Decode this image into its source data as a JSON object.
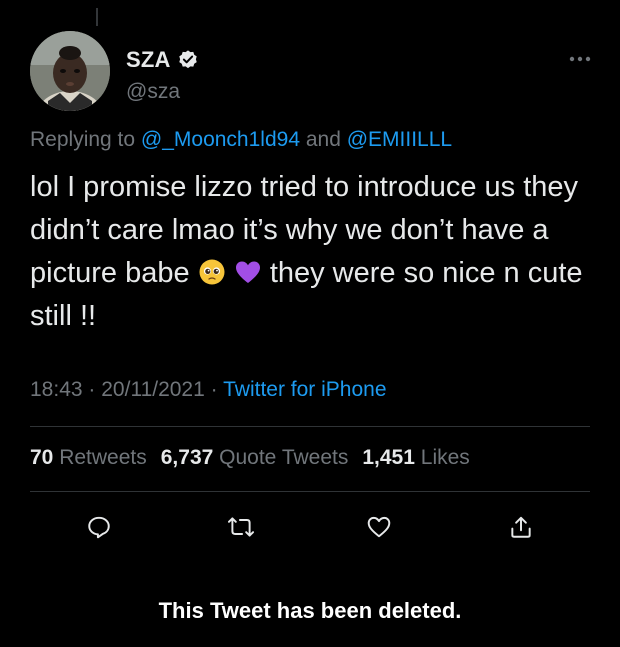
{
  "colors": {
    "background": "#000000",
    "primary_text": "#e7e9ea",
    "secondary_text": "#71767b",
    "accent": "#1d9bf0",
    "divider": "#2f3336"
  },
  "author": {
    "display_name": "SZA",
    "handle": "@sza",
    "verified": true,
    "avatar_icon": "child-portrait-avatar"
  },
  "reply_context": {
    "prefix": "Replying to",
    "mention_1": "@_Moonch1ld94",
    "conjunction": "and",
    "mention_2": "@EMIIILLL"
  },
  "tweet": {
    "text_part_1": "lol I promise lizzo tried to introduce us they didn’t care lmao it’s why we don’t have a picture babe",
    "emoji_1": "pleading-face-emoji",
    "emoji_2": "purple-heart-emoji",
    "text_part_2": "they were so nice n cute still !!"
  },
  "meta": {
    "time": "18:43",
    "separator": "·",
    "date": "20/11/2021",
    "source": "Twitter for iPhone"
  },
  "stats": {
    "retweets_count": "70",
    "retweets_label": "Retweets",
    "quotes_count": "6,737",
    "quotes_label": "Quote Tweets",
    "likes_count": "1,451",
    "likes_label": "Likes"
  },
  "actions": [
    "reply-icon",
    "retweet-icon",
    "like-icon",
    "share-icon"
  ],
  "footer": {
    "deleted_notice": "This Tweet has been deleted."
  }
}
